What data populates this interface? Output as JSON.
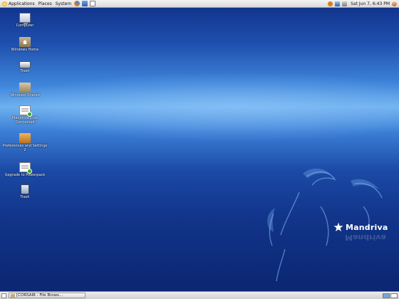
{
  "top_panel": {
    "menus": [
      {
        "label": "Applications",
        "icon": "mandriva-star-icon"
      },
      {
        "label": "Places"
      },
      {
        "label": "System"
      }
    ],
    "launchers": [
      "firefox-icon",
      "web-launcher-icon",
      "mail-launcher-icon"
    ],
    "tray_icons": [
      "update-icon",
      "network-icon",
      "volume-icon",
      "user-icon"
    ],
    "clock": "Sat Jun 7, 6:43 PM"
  },
  "desktop_icons": [
    {
      "label": "Computer",
      "icon": "computer-icon"
    },
    {
      "label": "Windows Home",
      "icon": "home-folder-icon"
    },
    {
      "label": "Trash",
      "icon": "drive-icon"
    },
    {
      "label": "Windows Shared",
      "icon": "folder-icon"
    },
    {
      "label": "Mandriva Club Connected",
      "icon": "document-check-icon"
    },
    {
      "label": "Preferences and Settings 2",
      "icon": "package-icon"
    },
    {
      "label": "Upgrade to Powerpack",
      "icon": "document-upgrade-icon"
    },
    {
      "label": "Trash",
      "icon": "trash-icon"
    }
  ],
  "wallpaper": {
    "brand": "Mandriva",
    "colors": {
      "top": "#0f2f86",
      "band": "#6cb0ef",
      "bottom": "#0b2670"
    }
  },
  "bottom_panel": {
    "taskbar_entries": [
      {
        "label": "[CORSAIR - File Brows...",
        "icon": "folder-icon"
      }
    ],
    "workspaces": 2
  }
}
